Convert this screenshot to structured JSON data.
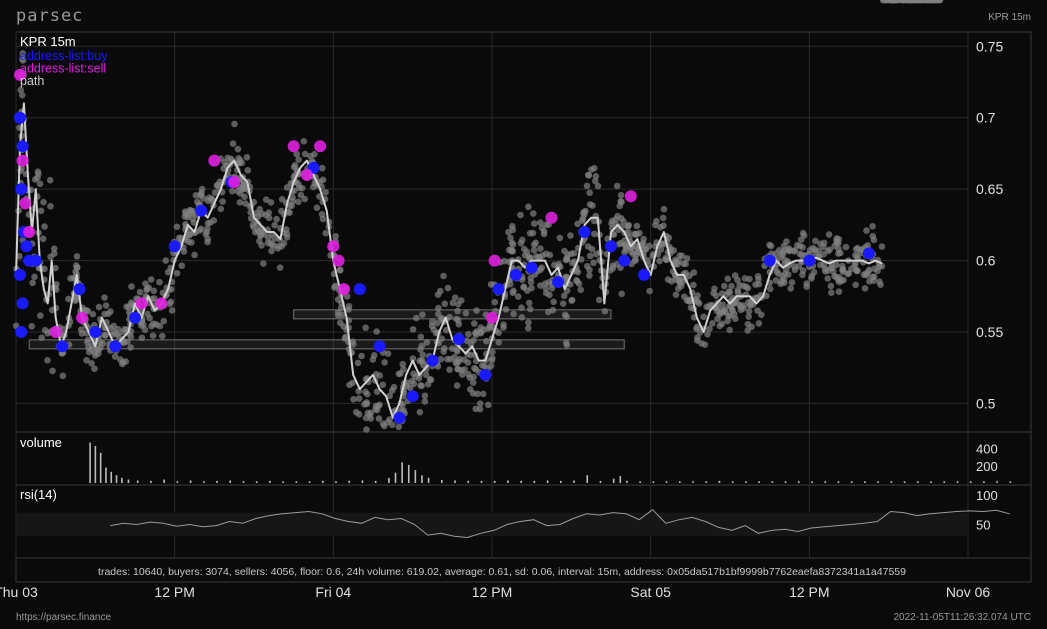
{
  "header": {
    "brand": "parsec",
    "ticker": "KPR 15m"
  },
  "footer": {
    "url": "https://parsec.finance",
    "timestamp": "2022-11-05T11:26:32.074 UTC"
  },
  "colors": {
    "buy": "#1a1aff",
    "sell": "#e020e0",
    "path": "#d0d0d0",
    "trades": "#808080",
    "grid": "#2a2a2a"
  },
  "chart_data": [
    {
      "type": "scatter",
      "title": "KPR 15m",
      "legend": [
        {
          "label": "address-list:buy",
          "color": "#1a1aff"
        },
        {
          "label": "address-list:sell",
          "color": "#e020e0"
        },
        {
          "label": "path",
          "color": "#cfcfcf"
        }
      ],
      "y_ticks": [
        "0.75",
        "0.7",
        "0.65",
        "0.6",
        "0.55",
        "0.5"
      ],
      "ylim": [
        0.48,
        0.76
      ],
      "x_ticks": [
        "Thu 03",
        "12 PM",
        "Fri 04",
        "12 PM",
        "Sat 05",
        "12 PM",
        "Nov 06"
      ],
      "xlim": [
        0,
        72
      ],
      "path": {
        "x": [
          0,
          0.3,
          0.6,
          0.9,
          1.2,
          1.5,
          1.8,
          2.1,
          2.4,
          2.7,
          3,
          3.4,
          3.8,
          4.2,
          4.6,
          5,
          5.5,
          6,
          6.5,
          7,
          7.5,
          8,
          8.5,
          9,
          9.5,
          10,
          10.5,
          11,
          11.5,
          12,
          12.5,
          13,
          13.5,
          14,
          14.5,
          15,
          15.5,
          16,
          16.5,
          17,
          17.5,
          18,
          18.5,
          19,
          19.5,
          20,
          20.5,
          21,
          21.5,
          22,
          22.5,
          23,
          23.5,
          24,
          24.5,
          25,
          25.5,
          26,
          26.5,
          27,
          27.5,
          28,
          28.5,
          29,
          29.5,
          30,
          30.5,
          31,
          31.5,
          32,
          32.5,
          33,
          33.5,
          34,
          34.5,
          35,
          35.5,
          36,
          36.5,
          37,
          37.5,
          38,
          38.5,
          39,
          39.5,
          40,
          40.5,
          41,
          41.5,
          42,
          42.5,
          43,
          43.5,
          44,
          44.5,
          45,
          45.5,
          46,
          46.5,
          47,
          47.5,
          48,
          48.5,
          49,
          49.5,
          50,
          50.5,
          51,
          51.5,
          52,
          52.5,
          53,
          53.5,
          54,
          54.5,
          55,
          55.5,
          56,
          56.5,
          57,
          57.5,
          58,
          58.5,
          59,
          59.5,
          60,
          60.5,
          61,
          61.5,
          62,
          62.5,
          63,
          63.5,
          64,
          64.5,
          65,
          65.5,
          66,
          66.5,
          67,
          67.5,
          68,
          68.5,
          69,
          69.5,
          70
        ],
        "y": [
          0.59,
          0.68,
          0.71,
          0.66,
          0.62,
          0.65,
          0.6,
          0.58,
          0.57,
          0.6,
          0.56,
          0.54,
          0.55,
          0.57,
          0.59,
          0.56,
          0.55,
          0.54,
          0.56,
          0.55,
          0.54,
          0.545,
          0.55,
          0.57,
          0.56,
          0.575,
          0.565,
          0.57,
          0.58,
          0.6,
          0.61,
          0.625,
          0.62,
          0.635,
          0.63,
          0.64,
          0.65,
          0.665,
          0.67,
          0.66,
          0.655,
          0.63,
          0.625,
          0.62,
          0.62,
          0.615,
          0.64,
          0.655,
          0.665,
          0.67,
          0.66,
          0.65,
          0.635,
          0.6,
          0.58,
          0.56,
          0.52,
          0.51,
          0.515,
          0.52,
          0.51,
          0.505,
          0.49,
          0.5,
          0.52,
          0.53,
          0.52,
          0.525,
          0.53,
          0.55,
          0.56,
          0.545,
          0.54,
          0.535,
          0.54,
          0.53,
          0.53,
          0.545,
          0.56,
          0.58,
          0.6,
          0.6,
          0.595,
          0.6,
          0.6,
          0.6,
          0.59,
          0.595,
          0.58,
          0.59,
          0.6,
          0.625,
          0.63,
          0.63,
          0.57,
          0.62,
          0.625,
          0.62,
          0.61,
          0.615,
          0.6,
          0.59,
          0.61,
          0.62,
          0.6,
          0.59,
          0.59,
          0.58,
          0.56,
          0.55,
          0.565,
          0.57,
          0.575,
          0.57,
          0.575,
          0.575,
          0.575,
          0.57,
          0.575,
          0.59,
          0.6,
          0.595,
          0.598,
          0.6,
          0.6,
          0.6,
          0.602,
          0.6,
          0.598,
          0.6,
          0.6,
          0.6,
          0.6,
          0.6,
          0.598,
          0.6,
          0.598
        ]
      },
      "buy_points": [
        [
          0.3,
          0.7
        ],
        [
          0.5,
          0.68
        ],
        [
          0.4,
          0.65
        ],
        [
          0.6,
          0.62
        ],
        [
          0.3,
          0.59
        ],
        [
          0.5,
          0.57
        ],
        [
          0.4,
          0.55
        ],
        [
          0.8,
          0.61
        ],
        [
          1.0,
          0.6
        ],
        [
          1.5,
          0.6
        ],
        [
          3.5,
          0.54
        ],
        [
          4.8,
          0.58
        ],
        [
          6,
          0.55
        ],
        [
          7.5,
          0.54
        ],
        [
          9,
          0.56
        ],
        [
          12,
          0.61
        ],
        [
          14,
          0.635
        ],
        [
          16.3,
          0.655
        ],
        [
          22.5,
          0.665
        ],
        [
          26,
          0.58
        ],
        [
          27.5,
          0.54
        ],
        [
          29,
          0.49
        ],
        [
          30,
          0.505
        ],
        [
          31.5,
          0.53
        ],
        [
          33.5,
          0.545
        ],
        [
          35.5,
          0.52
        ],
        [
          36.5,
          0.58
        ],
        [
          37.8,
          0.59
        ],
        [
          39,
          0.595
        ],
        [
          41,
          0.585
        ],
        [
          43,
          0.62
        ],
        [
          45,
          0.61
        ],
        [
          46,
          0.6
        ],
        [
          47.5,
          0.59
        ],
        [
          57,
          0.6
        ],
        [
          60,
          0.6
        ],
        [
          64.5,
          0.605
        ]
      ],
      "sell_points": [
        [
          0.3,
          0.73
        ],
        [
          0.5,
          0.67
        ],
        [
          0.7,
          0.64
        ],
        [
          1.0,
          0.62
        ],
        [
          3.0,
          0.55
        ],
        [
          5,
          0.56
        ],
        [
          9.5,
          0.57
        ],
        [
          11,
          0.57
        ],
        [
          15,
          0.67
        ],
        [
          16.5,
          0.655
        ],
        [
          21,
          0.68
        ],
        [
          22,
          0.66
        ],
        [
          23,
          0.68
        ],
        [
          24,
          0.61
        ],
        [
          24.4,
          0.6
        ],
        [
          24.8,
          0.58
        ],
        [
          36,
          0.56
        ],
        [
          36.2,
          0.6
        ],
        [
          40.5,
          0.63
        ],
        [
          46.5,
          0.645
        ]
      ],
      "ranges": [
        {
          "x0": 1,
          "x1": 46,
          "y": 0.541
        },
        {
          "x0": 21,
          "x1": 45,
          "y": 0.562
        }
      ]
    },
    {
      "type": "bar",
      "title": "volume",
      "y_ticks": [
        "400",
        "200"
      ],
      "ylim": [
        0,
        500
      ],
      "x": [
        0.4,
        0.8,
        1.2,
        1.6,
        2.0,
        2.4,
        2.8,
        3.3,
        4,
        5,
        6,
        7,
        8,
        9,
        10,
        11,
        12,
        13,
        14,
        15,
        16,
        17,
        18,
        19,
        20,
        21,
        22,
        23,
        23.5,
        24,
        24.5,
        25,
        25.5,
        26,
        27,
        28,
        29,
        30,
        31,
        32,
        33,
        34,
        35,
        36,
        37,
        38,
        39,
        40,
        40.5,
        41,
        42,
        43,
        44,
        45,
        46,
        47,
        48,
        49,
        50,
        51,
        52,
        53,
        54,
        55,
        56,
        57,
        58,
        59,
        60,
        61,
        62,
        63,
        64,
        65,
        66,
        67,
        68,
        69,
        70
      ],
      "values": [
        470,
        430,
        350,
        180,
        130,
        90,
        60,
        40,
        30,
        25,
        40,
        20,
        30,
        20,
        25,
        30,
        20,
        20,
        25,
        20,
        20,
        20,
        25,
        20,
        25,
        30,
        25,
        60,
        120,
        240,
        210,
        150,
        90,
        60,
        35,
        30,
        25,
        25,
        25,
        30,
        25,
        25,
        30,
        25,
        30,
        90,
        25,
        50,
        80,
        25,
        20,
        20,
        20,
        20,
        20,
        20,
        25,
        20,
        20,
        20,
        20,
        20,
        20,
        20,
        20,
        20,
        20,
        20,
        20,
        20,
        20,
        20,
        20,
        20,
        20,
        20,
        20,
        20,
        20
      ]
    },
    {
      "type": "line",
      "title": "rsi(14)",
      "y_ticks": [
        "100",
        "50"
      ],
      "ylim": [
        0,
        110
      ],
      "x": [
        2,
        3,
        4,
        5,
        6,
        7,
        8,
        9,
        10,
        11,
        12,
        13,
        14,
        15,
        16,
        17,
        18,
        19,
        20,
        21,
        22,
        23,
        24,
        25,
        26,
        27,
        28,
        29,
        30,
        31,
        32,
        33,
        34,
        35,
        36,
        37,
        38,
        39,
        40,
        41,
        42,
        43,
        44,
        45,
        46,
        47,
        48,
        49,
        50,
        51,
        52,
        53,
        54,
        55,
        56,
        57,
        58,
        59,
        60,
        61,
        62,
        63,
        64,
        65,
        66,
        67,
        68,
        69,
        70
      ],
      "values": [
        48,
        52,
        50,
        54,
        52,
        47,
        50,
        46,
        48,
        55,
        52,
        60,
        65,
        68,
        70,
        72,
        68,
        60,
        55,
        52,
        62,
        58,
        60,
        50,
        32,
        35,
        30,
        28,
        35,
        40,
        50,
        55,
        58,
        48,
        50,
        60,
        68,
        66,
        70,
        68,
        58,
        75,
        52,
        58,
        62,
        55,
        45,
        40,
        48,
        35,
        40,
        42,
        38,
        44,
        46,
        48,
        50,
        52,
        55,
        72,
        70,
        65,
        68,
        70,
        72,
        73,
        72,
        74,
        68
      ]
    }
  ],
  "stats": "trades: 10640,  buyers: 3074,  sellers: 4056,  floor: 0.6,  24h volume: 619.02,  average: 0.61,  sd: 0.06,  interval: 15m,  address: 0x05da517b1bf9999b7762eaefa8372341a1a47559"
}
